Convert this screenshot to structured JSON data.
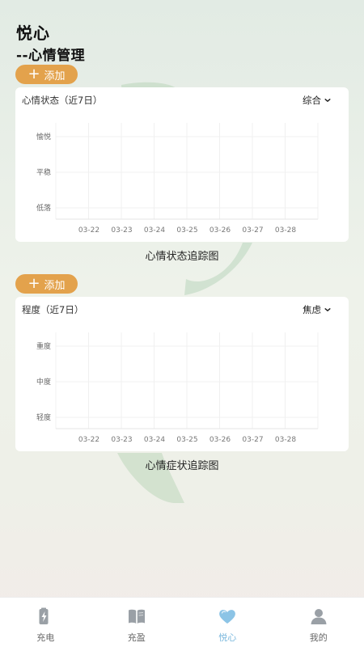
{
  "header": {
    "title": "悦心",
    "subtitle": "--心情管理"
  },
  "add_button_label": "添加",
  "colors": {
    "accent": "#e3a24c",
    "tab_active": "#7bb8dd",
    "tab_inactive": "#999999",
    "leaf": "#c8dcc8"
  },
  "mood_card": {
    "title": "心情状态（近7日）",
    "selected": "综合",
    "caption": "心情状态追踪图",
    "chart_data": {
      "type": "line",
      "categories": [
        "03-22",
        "03-23",
        "03-24",
        "03-25",
        "03-26",
        "03-27",
        "03-28"
      ],
      "y_categories": [
        "愉悦",
        "平稳",
        "低落"
      ],
      "series": [],
      "grid": true
    }
  },
  "symptom_card": {
    "title": "程度（近7日）",
    "selected": "焦虑",
    "caption": "心情症状追踪图",
    "chart_data": {
      "type": "line",
      "categories": [
        "03-22",
        "03-23",
        "03-24",
        "03-25",
        "03-26",
        "03-27",
        "03-28"
      ],
      "y_categories": [
        "重度",
        "中度",
        "轻度"
      ],
      "series": [],
      "grid": true
    }
  },
  "tabs": [
    {
      "label": "充电",
      "icon": "battery-bolt-icon",
      "active": false
    },
    {
      "label": "充盈",
      "icon": "book-icon",
      "active": false
    },
    {
      "label": "悦心",
      "icon": "heart-icon",
      "active": true
    },
    {
      "label": "我的",
      "icon": "user-icon",
      "active": false
    }
  ]
}
